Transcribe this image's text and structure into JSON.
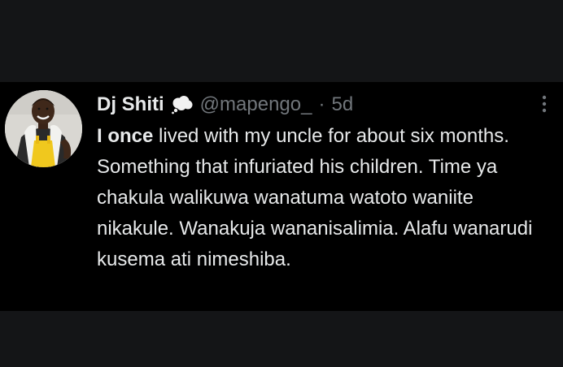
{
  "tweet": {
    "author": {
      "name": "Dj Shiti",
      "badge_icon": "thought-bubble-icon",
      "handle": "@mapengo_",
      "avatar_icon": "profile-photo"
    },
    "separator": "·",
    "time": "5d",
    "more_icon": "vertical-ellipsis-icon",
    "text": {
      "bold_lead": "I once",
      "rest": " lived with my uncle for about six months. Something that infuriated his children. Time ya chakula walikuwa wanatuma watoto waniite nikakule. Wanakuja wananisalimia. Alafu wanarudi kusema ati nimeshiba."
    }
  },
  "colors": {
    "background": "#000000",
    "outer_band": "#141517",
    "primary_text": "#e7e9ea",
    "secondary_text": "#71767b"
  }
}
